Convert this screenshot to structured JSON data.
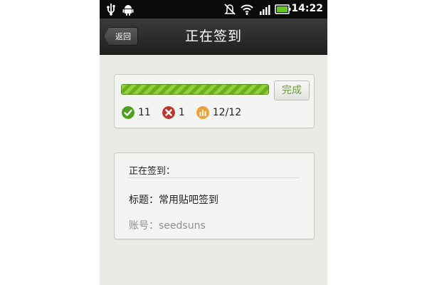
{
  "status_bar": {
    "time": "14:22",
    "icons": [
      "usb-icon",
      "android-icon",
      "mute-icon",
      "wifi-icon",
      "signal-icon",
      "battery-icon"
    ]
  },
  "header": {
    "back_label": "返回",
    "title": "正在签到"
  },
  "progress": {
    "fraction": 1.0,
    "done_label": "完成",
    "success_count": "11",
    "fail_count": "1",
    "progress_text": "12/12",
    "colors": {
      "success": "#4ea21a",
      "fail": "#c0342e",
      "total": "#f0a030",
      "bar": "#7cc230"
    }
  },
  "info": {
    "header": "正在签到：",
    "title_line": "标题：常用贴吧签到",
    "account_line": "账号：seedsuns"
  }
}
